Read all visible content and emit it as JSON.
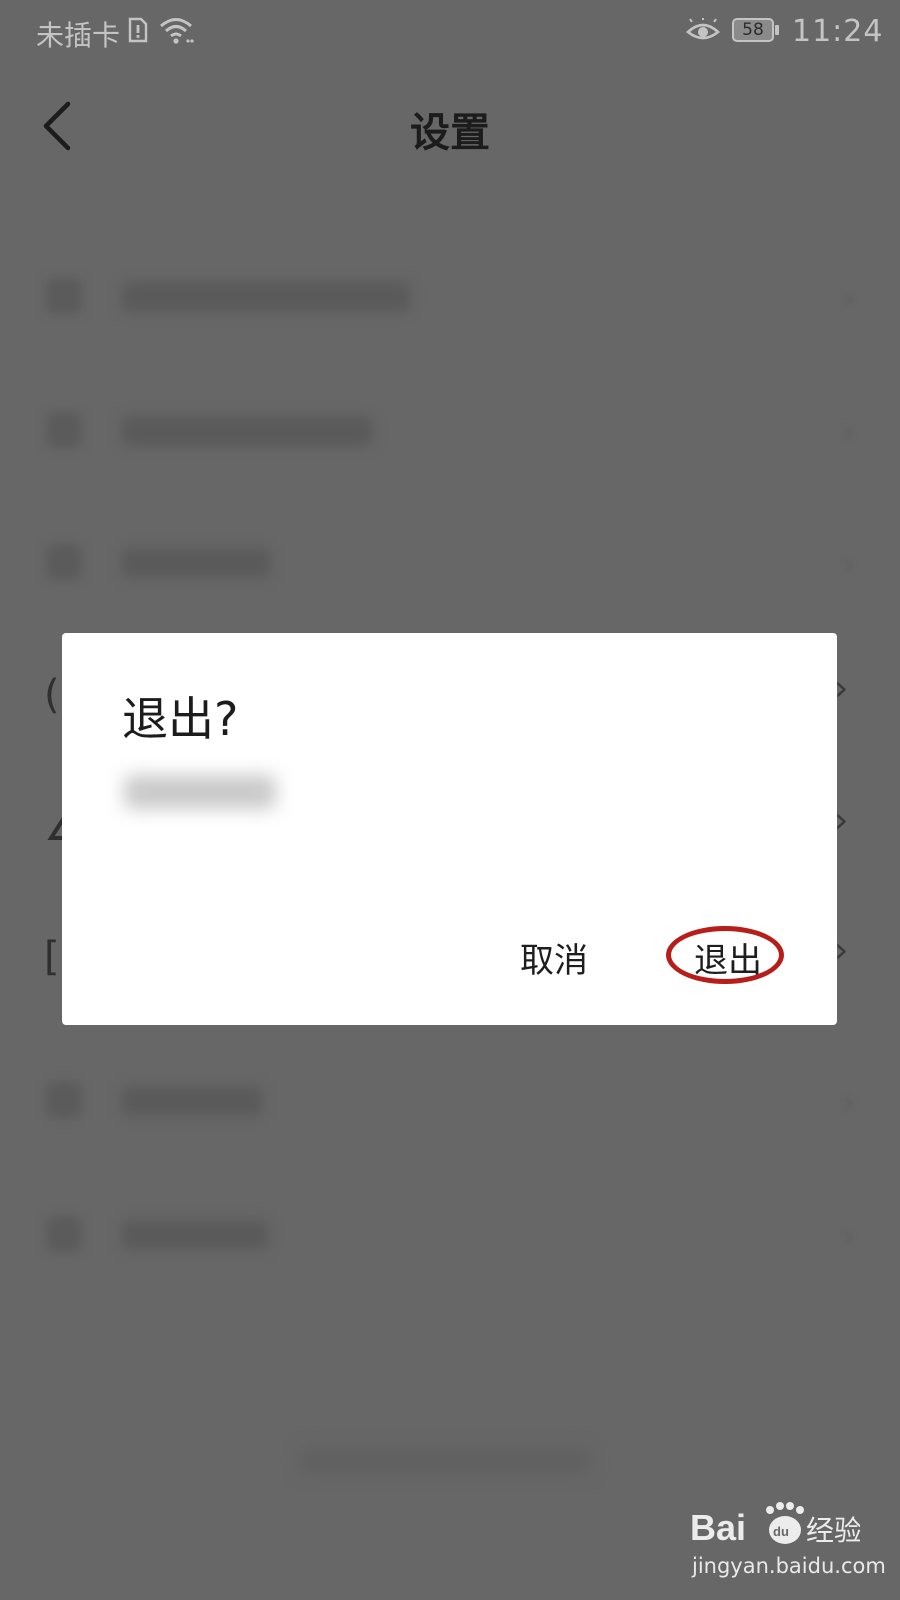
{
  "status_bar": {
    "carrier": "未插卡",
    "battery_level": "58",
    "time": "11:24",
    "icons": [
      "sim-icon",
      "wifi-icon",
      "eye-comfort-icon",
      "battery-icon"
    ]
  },
  "header": {
    "title": "设置",
    "back_icon": "chevron-left-icon"
  },
  "dialog": {
    "title": "退出?",
    "cancel_label": "取消",
    "confirm_label": "退出",
    "highlight_color": "#b81e19"
  },
  "watermark": {
    "logo_text": "Bai经验",
    "site": "jingyan.baidu.com"
  },
  "colors": {
    "overlay_bg": "#676767",
    "dialog_bg": "#ffffff",
    "text": "#1c1c1c"
  }
}
